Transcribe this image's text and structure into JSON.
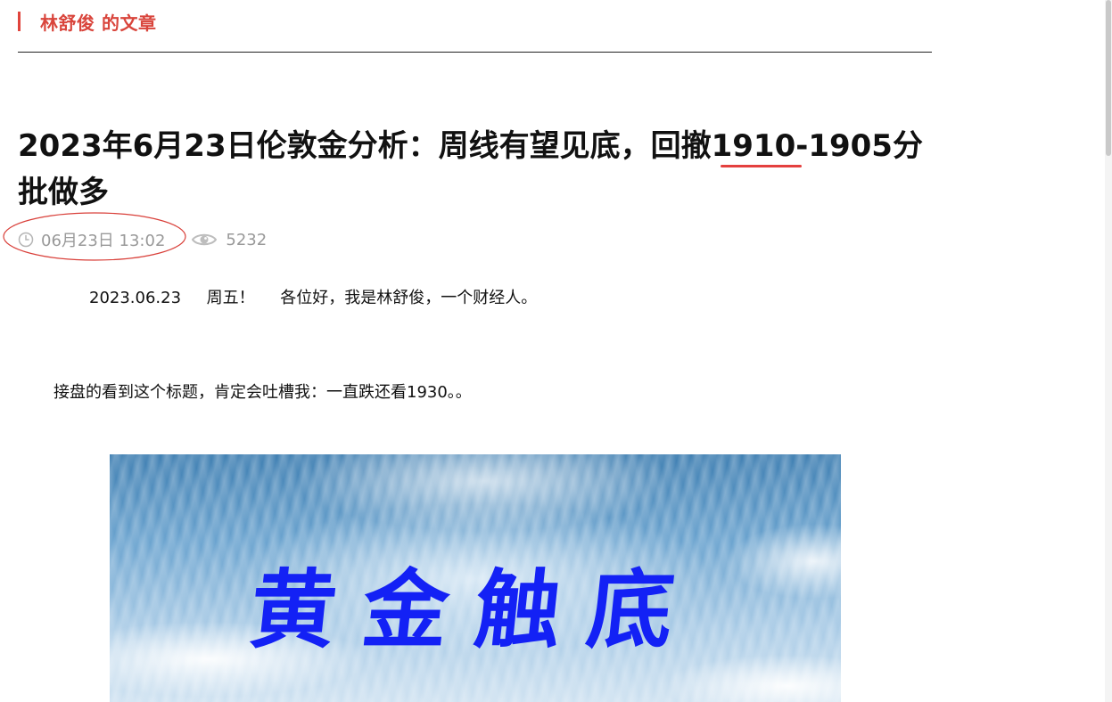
{
  "section": {
    "title": "林舒俊 的文章",
    "accent_color": "#e0443c"
  },
  "article": {
    "title": "2023年6月23日伦敦金分析：周线有望见底，回撤1910-1905分批做多",
    "meta": {
      "date_icon": "clock-icon",
      "date": "06月23日 13:02",
      "views_icon": "eye-icon",
      "views": "5232"
    },
    "paragraphs": [
      "2023.06.23     周五！     各位好，我是林舒俊，一个财经人。",
      "接盘的看到这个标题，肯定会吐槽我：一直跌还看1930。。"
    ],
    "hero_image": {
      "text": "黄金触底"
    }
  }
}
